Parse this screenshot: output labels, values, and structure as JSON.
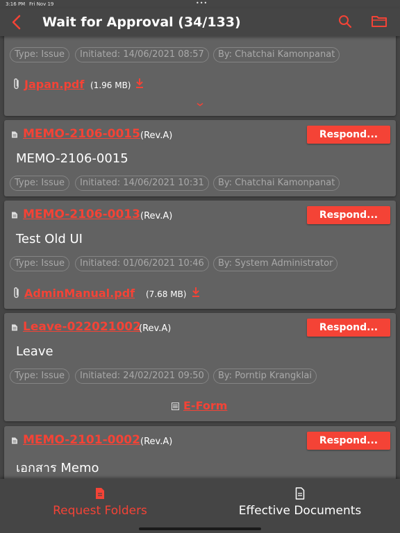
{
  "status_bar": {
    "time": "3:16 PM",
    "date": "Fri Nov 19"
  },
  "header": {
    "title": "Wait for Approval (34/133)"
  },
  "colors": {
    "accent": "#f44336",
    "background": "#454545",
    "card": "#626262"
  },
  "cards": [
    {
      "subject": "",
      "chips": [
        "Type: Issue",
        "Initiated: 14/06/2021 08:57",
        "By: Chatchai Kamonpanat"
      ],
      "attachment": {
        "name": "Japan.pdf",
        "size": "(1.96 MB)"
      }
    },
    {
      "doc_no": "MEMO-2106-0015",
      "rev": "(Rev.A)",
      "respond": "Respond...",
      "subject": "MEMO-2106-0015",
      "chips": [
        "Type: Issue",
        "Initiated: 14/06/2021 10:31",
        "By: Chatchai Kamonpanat"
      ]
    },
    {
      "doc_no": "MEMO-2106-0013",
      "rev": "(Rev.A)",
      "respond": "Respond...",
      "subject": "Test Old UI",
      "chips": [
        "Type: Issue",
        "Initiated: 01/06/2021 10:46",
        "By: System Administrator"
      ],
      "attachment": {
        "name": "AdminManual.pdf",
        "size": "(7.68 MB)"
      }
    },
    {
      "doc_no": "Leave-022021002",
      "rev": "(Rev.A)",
      "respond": "Respond...",
      "subject": "Leave",
      "chips": [
        "Type: Issue",
        "Initiated: 24/02/2021 09:50",
        "By: Porntip Krangklai"
      ],
      "eform": "E-Form"
    },
    {
      "doc_no": "MEMO-2101-0002",
      "rev": "(Rev.A)",
      "respond": "Respond...",
      "subject": "เอกสาร Memo"
    }
  ],
  "bottom_tabs": [
    {
      "label": "Request Folders",
      "active": true
    },
    {
      "label": "Effective Documents",
      "active": false
    }
  ]
}
